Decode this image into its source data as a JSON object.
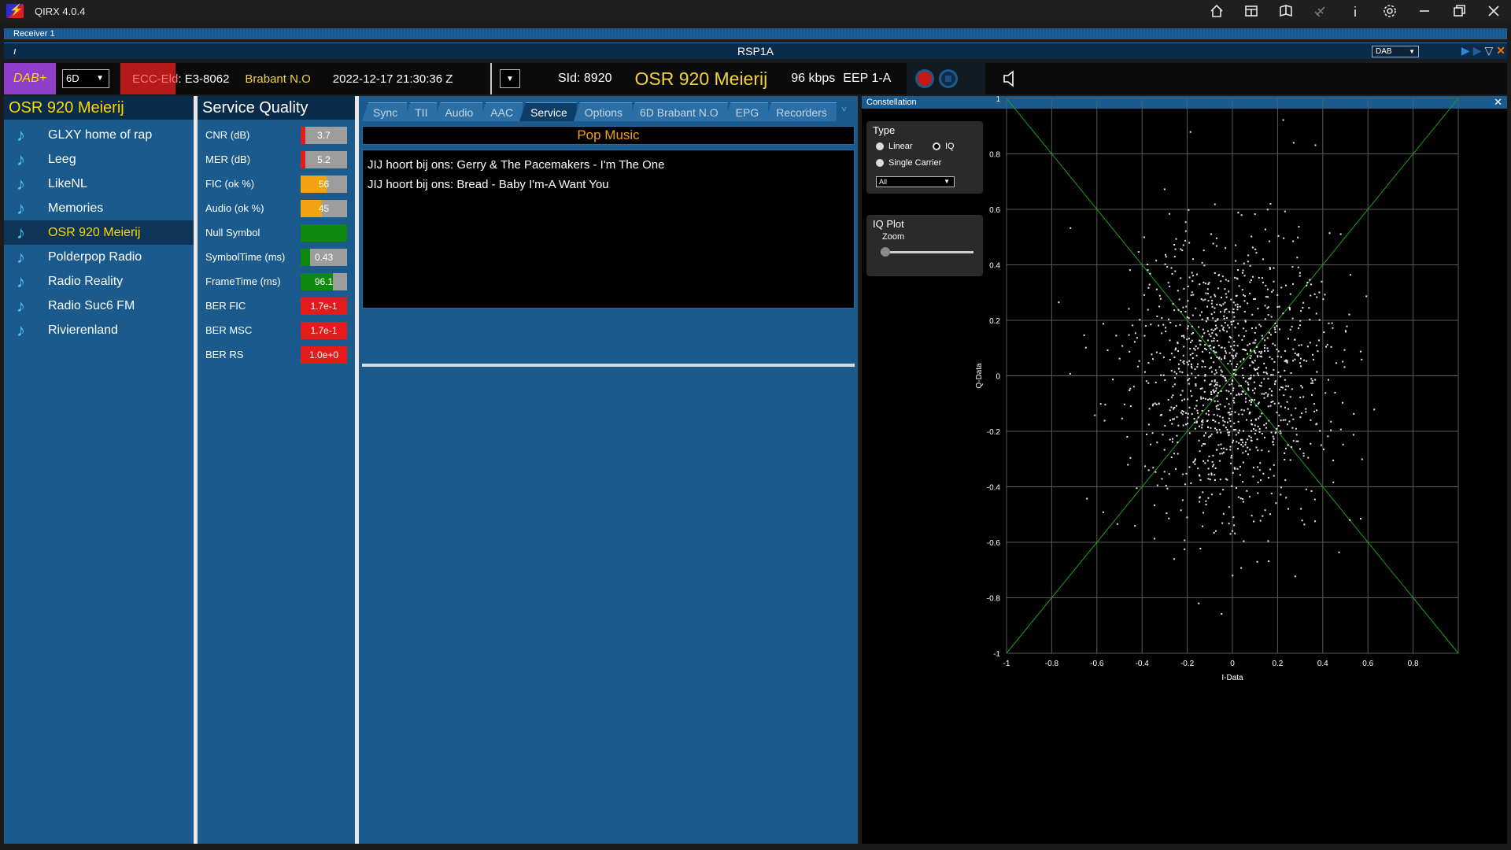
{
  "window": {
    "title": "QIRX 4.0.4"
  },
  "receiver": {
    "label": "Receiver 1",
    "pin": "ı",
    "device": "RSP1A",
    "mode": "DAB"
  },
  "info": {
    "badge": "DAB+",
    "channel": "6D",
    "ecc_label": "ECC-Eld",
    "ecc_value": ": E3-8062",
    "ensemble": "Brabant N.O",
    "datetime": "2022-12-17  21:30:36 Z",
    "sid": "SId: 8920",
    "service": "OSR 920 Meierij",
    "bitrate": "96 kbps",
    "protection": "EEP 1-A"
  },
  "services": {
    "title": "OSR 920 Meierij",
    "items": [
      {
        "label": "GLXY home of rap"
      },
      {
        "label": "Leeg"
      },
      {
        "label": "LikeNL"
      },
      {
        "label": "Memories"
      },
      {
        "label": "OSR 920 Meierij"
      },
      {
        "label": "Polderpop Radio"
      },
      {
        "label": "Radio Reality"
      },
      {
        "label": "Radio Suc6 FM"
      },
      {
        "label": "Rivierenland"
      }
    ],
    "selected_index": 4
  },
  "quality": {
    "title": "Service Quality",
    "rows": [
      {
        "label": "CNR (dB)",
        "value": "3.7",
        "fill": 0.1,
        "color": "#e31b1b"
      },
      {
        "label": "MER (dB)",
        "value": "5.2",
        "fill": 0.1,
        "color": "#e31b1b"
      },
      {
        "label": "FIC (ok %)",
        "value": "56",
        "fill": 0.56,
        "color": "#f3a30f"
      },
      {
        "label": "Audio (ok %)",
        "value": "45",
        "fill": 0.45,
        "color": "#f3a30f"
      },
      {
        "label": "Null Symbol",
        "value": "",
        "fill": 1.0,
        "color": "#0d8a0d"
      },
      {
        "label": "SymbolTime (ms)",
        "value": "0.43",
        "fill": 0.2,
        "color": "#0d8a0d"
      },
      {
        "label": "FrameTime (ms)",
        "value": "96.1",
        "fill": 0.7,
        "color": "#0d8a0d"
      },
      {
        "label": "BER FIC",
        "value": "1.7e-1",
        "fill": 1.0,
        "color": "#e31b1b"
      },
      {
        "label": "BER MSC",
        "value": "1.7e-1",
        "fill": 1.0,
        "color": "#e31b1b"
      },
      {
        "label": "BER RS",
        "value": "1.0e+0",
        "fill": 1.0,
        "color": "#e31b1b"
      }
    ]
  },
  "tabs": {
    "items": [
      "Sync",
      "TII",
      "Audio",
      "AAC",
      "Service",
      "Options",
      "6D Brabant N.O",
      "EPG",
      "Recorders"
    ],
    "active": "Service",
    "scroll": "‹ › ˅"
  },
  "service_info": {
    "genre": "Pop Music",
    "dls": [
      "JIJ hoort bij ons: Gerry & The Pacemakers - I'm The One",
      "JIJ hoort bij ons: Bread - Baby I'm-A Want You"
    ]
  },
  "constellation": {
    "title": "Constellation",
    "type_label": "Type",
    "linear_label": "Linear",
    "iq_label": "IQ",
    "single_carrier_label": "Single Carrier",
    "type_select": "All",
    "iq_plot_label": "IQ Plot",
    "zoom_label": "Zoom",
    "zoom_value": 0
  },
  "chart_data": {
    "type": "scatter",
    "xlabel": "I-Data",
    "ylabel": "Q-Data",
    "xlim": [
      -1,
      1
    ],
    "ylim": [
      -1,
      1
    ],
    "xticks": [
      -1,
      -0.8,
      -0.6,
      -0.4,
      -0.2,
      0,
      0.2,
      0.4,
      0.6,
      0.8
    ],
    "yticks": [
      1,
      0.8,
      0.6,
      0.4,
      0.2,
      0,
      -0.2,
      -0.4,
      -0.6,
      -0.8,
      -1
    ],
    "grid": true,
    "reference_lines": [
      [
        [
          -1,
          -1
        ],
        [
          1,
          1
        ]
      ],
      [
        [
          -1,
          1
        ],
        [
          1,
          -1
        ]
      ]
    ],
    "distribution": {
      "center": [
        0,
        0
      ],
      "std": 0.22,
      "count": 1200
    }
  }
}
